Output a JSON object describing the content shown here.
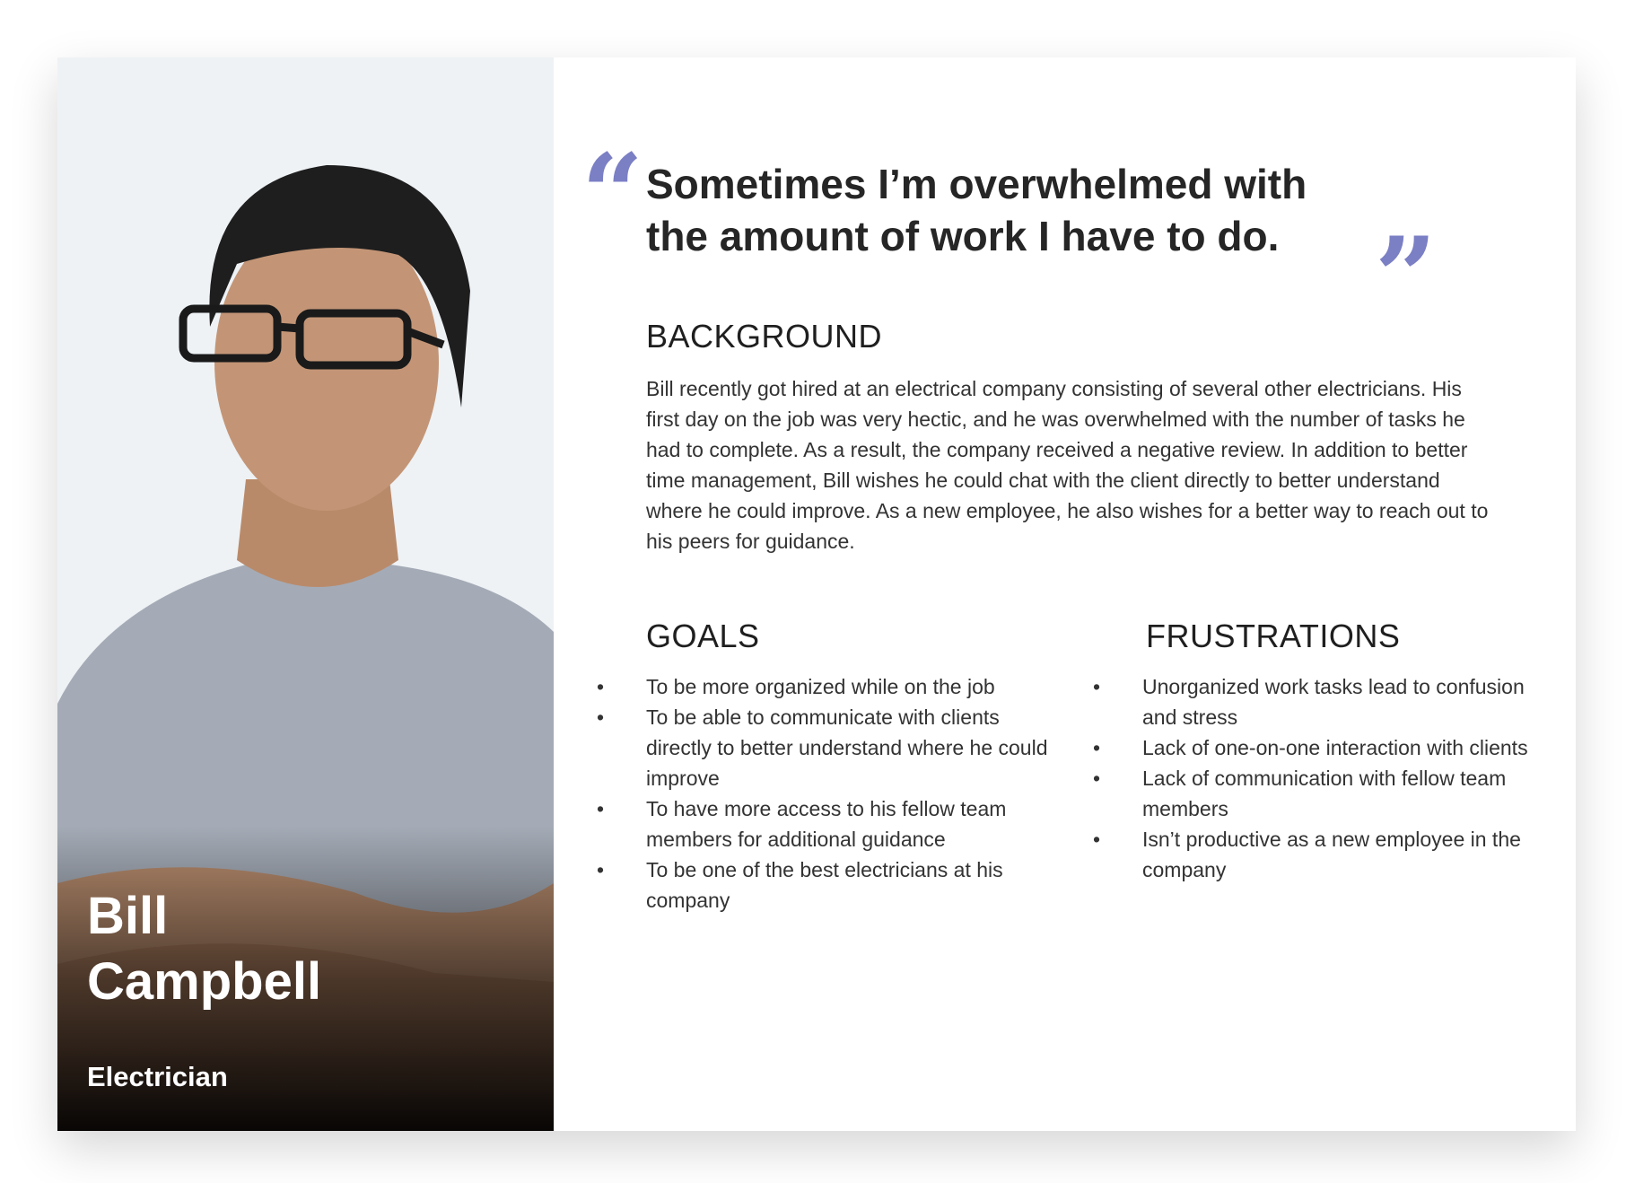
{
  "persona": {
    "name_first": "Bill",
    "name_last": "Campbell",
    "role": "Electrician"
  },
  "quote": {
    "text": "Sometimes I’m overwhelmed with the amount of work I have to do.",
    "open_mark": "“",
    "close_mark": "”"
  },
  "background": {
    "heading": "BACKGROUND",
    "text": "Bill recently got hired at an electrical company consisting of several other electricians. His first day on the job was very hectic, and he was overwhelmed with the number of tasks he had to complete. As a result, the company received a negative review. In addition to better time management, Bill wishes he could chat with the client directly to better understand where he could improve. As a new employee, he also wishes for a better way to reach out to his peers for guidance."
  },
  "goals": {
    "heading": "GOALS",
    "items": [
      "To be more organized while on the job",
      "To be able to communicate with clients directly to better understand where he could improve",
      "To have more access to his fellow team members for additional guidance",
      "To be one of the best electricians at his company"
    ]
  },
  "frustrations": {
    "heading": "FRUSTRATIONS",
    "items": [
      "Unorganized work tasks lead to confusion and stress",
      "Lack of one-on-one interaction with clients",
      "Lack of communication with fellow team members",
      "Isn’t productive as a new employee in the company"
    ]
  },
  "bullet": "•",
  "colors": {
    "accent": "#7b7fc4",
    "text": "#262626"
  }
}
